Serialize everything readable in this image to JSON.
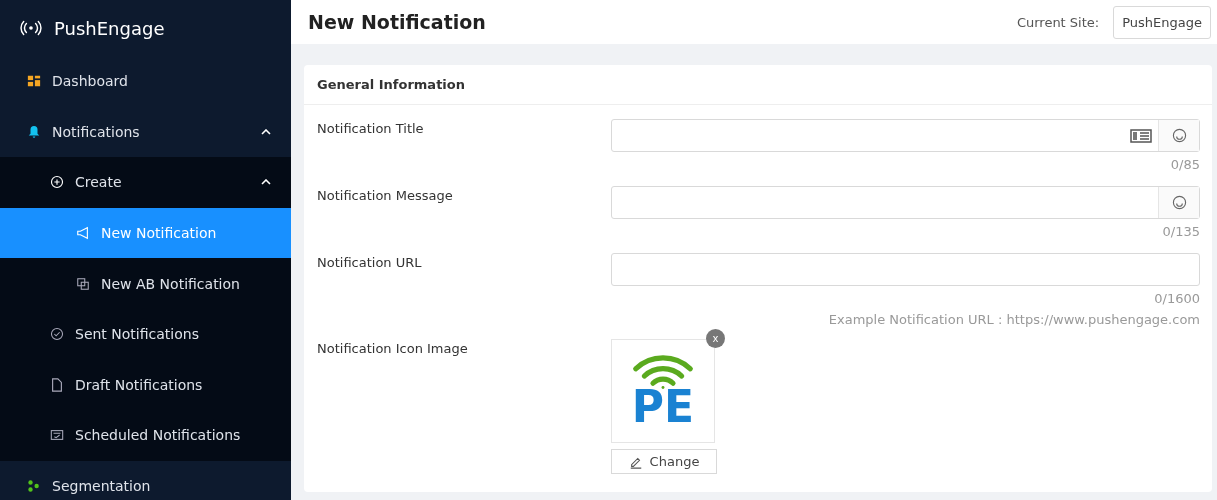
{
  "brand": {
    "name": "PushEngage"
  },
  "sidebar": {
    "items": [
      {
        "label": "Dashboard",
        "selected": false
      },
      {
        "label": "Notifications",
        "selected": false,
        "expanded": true,
        "children": [
          {
            "label": "Create",
            "selected": false,
            "expanded": true,
            "children": [
              {
                "label": "New Notification",
                "selected": true
              },
              {
                "label": "New AB Notification",
                "selected": false
              }
            ]
          },
          {
            "label": "Sent Notifications",
            "selected": false
          },
          {
            "label": "Draft Notifications",
            "selected": false
          },
          {
            "label": "Scheduled Notifications",
            "selected": false
          }
        ]
      },
      {
        "label": "Segmentation",
        "selected": false
      }
    ]
  },
  "header": {
    "title": "New Notification",
    "site_label": "Current Site:",
    "site_value": "PushEngage"
  },
  "card": {
    "title": "General Information",
    "fields": [
      {
        "label": "Notification Title",
        "kind": "text",
        "counter": "0/85",
        "book_button": true,
        "emoji_button": true
      },
      {
        "label": "Notification Message",
        "kind": "text",
        "counter": "0/135",
        "emoji_button": true
      },
      {
        "label": "Notification URL",
        "kind": "text",
        "counter": "0/1600",
        "hint": "Example Notification URL : https://www.pushengage.com"
      },
      {
        "label": "Notification Icon Image",
        "kind": "image",
        "image_text": "PE",
        "remove": "x",
        "button": "Change"
      }
    ]
  }
}
